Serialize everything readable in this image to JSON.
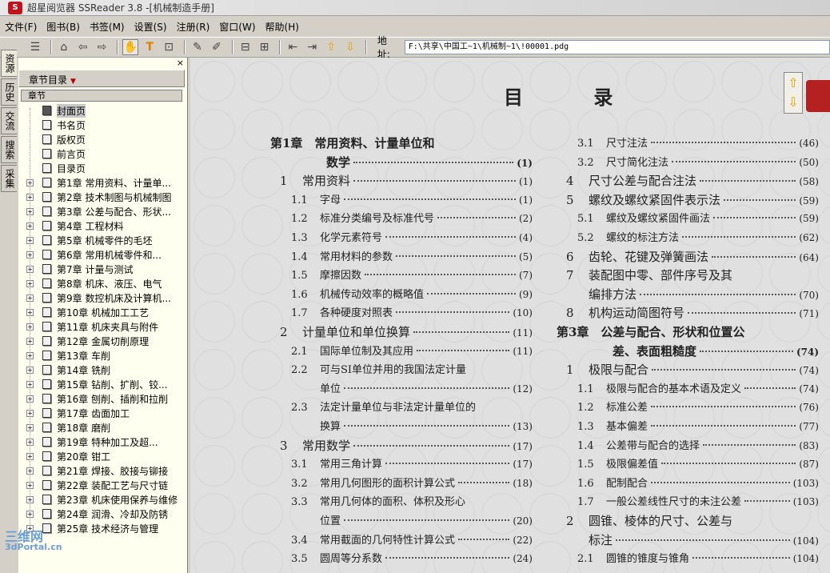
{
  "window": {
    "title": "超星阅览器 SSReader 3.8 -[机械制造手册]"
  },
  "menu": [
    "文件(F)",
    "图书(B)",
    "书签(M)",
    "设置(S)",
    "注册(R)",
    "窗口(W)",
    "帮助(H)"
  ],
  "address": {
    "label": "地址:",
    "value": "F:\\共享\\中国工~1\\机械制~1\\!00001.pdg"
  },
  "side_tabs": [
    "资源",
    "历史",
    "交流",
    "搜索",
    "采集"
  ],
  "panel": {
    "header": "章节目录",
    "column": "章节",
    "close": "×",
    "items": [
      "封面页",
      "书名页",
      "版权页",
      "前言页",
      "目录页",
      "第1章 常用资料、计量单...",
      "第2章 技术制图与机械制图",
      "第3章 公差与配合、形状...",
      "第4章 工程材料",
      "第5章 机械零件的毛坯",
      "第6章 常用机械零件和...",
      "第7章 计量与测试",
      "第8章 机床、液压、电气",
      "第9章 数控机床及计算机...",
      "第10章  机械加工工艺",
      "第11章 机床夹具与附件",
      "第12章 金属切削原理",
      "第13章 车削",
      "第14章 铣削",
      "第15章 钻削、扩削、铰...",
      "第16章  刨削、插削和拉削",
      "第17章 齿面加工",
      "第18章  磨削",
      "第19章 特种加工及超...",
      "第20章 钳工",
      "第21章 焊接、胶接与铆接",
      "第22章 装配工艺与尺寸链",
      "第23章 机床使用保养与维修",
      "第24章 润滑、冷却及防锈",
      "第25章 技术经济与管理"
    ]
  },
  "doc": {
    "title": "目 录",
    "left": [
      {
        "t": "第1章　常用资料、计量单位和",
        "k": "ch",
        "p": ""
      },
      {
        "t": "数学",
        "k": "chi",
        "p": "(1)"
      },
      {
        "n": "1",
        "t": "常用资料",
        "k": "s1",
        "p": "(1)"
      },
      {
        "n": "1.1",
        "t": "字母",
        "k": "s2",
        "p": "(1)"
      },
      {
        "n": "1.2",
        "t": "标准分类编号及标准代号",
        "k": "s2",
        "p": "(2)"
      },
      {
        "n": "1.3",
        "t": "化学元素符号",
        "k": "s2",
        "p": "(4)"
      },
      {
        "n": "1.4",
        "t": "常用材料的参数",
        "k": "s2",
        "p": "(5)"
      },
      {
        "n": "1.5",
        "t": "摩擦因数",
        "k": "s2",
        "p": "(7)"
      },
      {
        "n": "1.6",
        "t": "机械传动效率的概略值",
        "k": "s2",
        "p": "(9)"
      },
      {
        "n": "1.7",
        "t": "各种硬度对照表",
        "k": "s2",
        "p": "(10)"
      },
      {
        "n": "2",
        "t": "计量单位和单位换算",
        "k": "s1",
        "p": "(11)"
      },
      {
        "n": "2.1",
        "t": "国际单位制及其应用",
        "k": "s2",
        "p": "(11)"
      },
      {
        "n": "2.2",
        "t": "可与SI单位并用的我国法定计量",
        "k": "s2n",
        "p": ""
      },
      {
        "t": "单位",
        "k": "s2i",
        "p": "(12)"
      },
      {
        "n": "2.3",
        "t": "法定计量单位与非法定计量单位的",
        "k": "s2n",
        "p": ""
      },
      {
        "t": "换算",
        "k": "s2i",
        "p": "(13)"
      },
      {
        "n": "3",
        "t": "常用数学",
        "k": "s1",
        "p": "(17)"
      },
      {
        "n": "3.1",
        "t": "常用三角计算",
        "k": "s2",
        "p": "(17)"
      },
      {
        "n": "3.2",
        "t": "常用几何图形的面积计算公式",
        "k": "s2",
        "p": "(18)"
      },
      {
        "n": "3.3",
        "t": "常用几何体的面积、体积及形心",
        "k": "s2n",
        "p": ""
      },
      {
        "t": "位置",
        "k": "s2i",
        "p": "(20)"
      },
      {
        "n": "3.4",
        "t": "常用截面的几何特性计算公式",
        "k": "s2",
        "p": "(22)"
      },
      {
        "n": "3.5",
        "t": "圆周等分系数",
        "k": "s2",
        "p": "(24)"
      }
    ],
    "right": [
      {
        "n": "3.1",
        "t": "尺寸注法",
        "k": "s2",
        "p": "(46)"
      },
      {
        "n": "3.2",
        "t": "尺寸简化注法",
        "k": "s2",
        "p": "(50)"
      },
      {
        "n": "4",
        "t": "尺寸公差与配合注法",
        "k": "s1",
        "p": "(58)"
      },
      {
        "n": "5",
        "t": "螺纹及螺纹紧固件表示法",
        "k": "s1",
        "p": "(59)"
      },
      {
        "n": "5.1",
        "t": "螺纹及螺纹紧固件画法",
        "k": "s2",
        "p": "(59)"
      },
      {
        "n": "5.2",
        "t": "螺纹的标注方法",
        "k": "s2",
        "p": "(62)"
      },
      {
        "n": "6",
        "t": "齿轮、花键及弹簧画法",
        "k": "s1",
        "p": "(64)"
      },
      {
        "n": "7",
        "t": "装配图中零、部件序号及其",
        "k": "s1n",
        "p": ""
      },
      {
        "t": "编排方法",
        "k": "s1i",
        "p": "(70)"
      },
      {
        "n": "8",
        "t": "机构运动简图符号",
        "k": "s1",
        "p": "(71)"
      },
      {
        "t": "第3章　公差与配合、形状和位置公",
        "k": "ch",
        "p": ""
      },
      {
        "t": "差、表面粗糙度",
        "k": "chi",
        "p": "(74)"
      },
      {
        "n": "1",
        "t": "极限与配合",
        "k": "s1",
        "p": "(74)"
      },
      {
        "n": "1.1",
        "t": "极限与配合的基本术语及定义",
        "k": "s2",
        "p": "(74)"
      },
      {
        "n": "1.2",
        "t": "标准公差",
        "k": "s2",
        "p": "(76)"
      },
      {
        "n": "1.3",
        "t": "基本偏差",
        "k": "s2",
        "p": "(77)"
      },
      {
        "n": "1.4",
        "t": "公差带与配合的选择",
        "k": "s2",
        "p": "(83)"
      },
      {
        "n": "1.5",
        "t": "极限偏差值",
        "k": "s2",
        "p": "(87)"
      },
      {
        "n": "1.6",
        "t": "配制配合",
        "k": "s2",
        "p": "(103)"
      },
      {
        "n": "1.7",
        "t": "一般公差线性尺寸的未注公差",
        "k": "s2",
        "p": "(103)"
      },
      {
        "n": "2",
        "t": "圆锥、棱体的尺寸、公差与",
        "k": "s1n",
        "p": ""
      },
      {
        "t": "标注",
        "k": "s1i",
        "p": "(104)"
      },
      {
        "n": "2.1",
        "t": "圆锥的锥度与锥角",
        "k": "s2",
        "p": "(104)"
      }
    ]
  },
  "watermark": {
    "l1": "三维网",
    "l2": "3dPortal.cn"
  }
}
